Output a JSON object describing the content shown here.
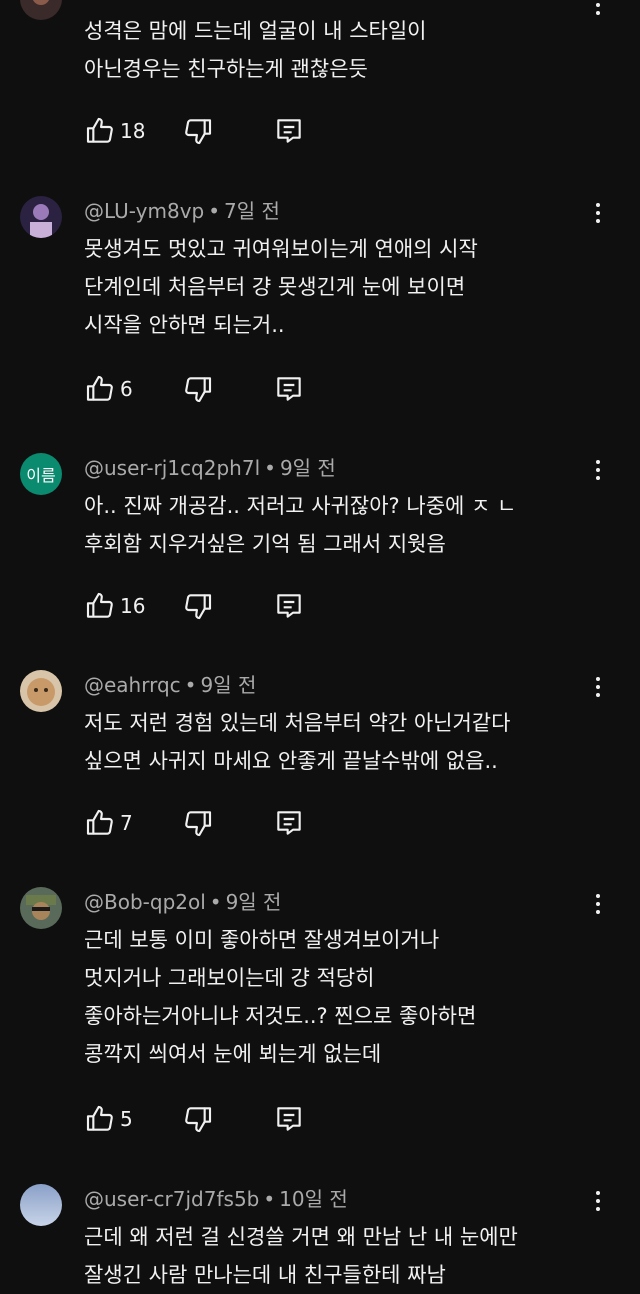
{
  "comments": [
    {
      "author": "",
      "time": "",
      "lines": [
        "성격은 맘에 드는데 얼굴이 내 스타일이",
        "아닌경우는 친구하는게 괜찮은듯"
      ],
      "likes": "18",
      "avatar": "photo-dark"
    },
    {
      "author": "@LU-ym8vp",
      "time": "7일 전",
      "lines": [
        "못생겨도 멋있고 귀여워보이는게 연애의 시작",
        "단계인데 처음부터 걍 못생긴게 눈에 보이면",
        "시작을 안하면 되는거.."
      ],
      "likes": "6",
      "avatar": "photo-purple"
    },
    {
      "author": "@user-rj1cq2ph7l",
      "time": "9일 전",
      "lines": [
        "아.. 진짜 개공감.. 저러고 사귀잖아? 나중에 ㅈ ㄴ",
        "후회함 지우거싶은 기억 됨 그래서 지웟음"
      ],
      "likes": "16",
      "avatar": "initial",
      "avatar_text": "이름",
      "avatar_color": "#0a8a6f"
    },
    {
      "author": "@eahrrqc",
      "time": "9일 전",
      "lines": [
        "저도 저런 경험 있는데 처음부터 약간 아닌거같다",
        "싶으면 사귀지 마세요 안좋게 끝날수밖에 없음.."
      ],
      "likes": "7",
      "avatar": "photo-cat"
    },
    {
      "author": "@Bob-qp2ol",
      "time": "9일 전",
      "lines": [
        "근데 보통 이미 좋아하면 잘생겨보이거나",
        "멋지거나 그래보이는데 걍 적당히",
        "좋아하는거아니냐 저것도..? 찐으로 좋아하면",
        "콩깍지 씌여서 눈에 뵈는게 없는데"
      ],
      "likes": "5",
      "avatar": "photo-soldier"
    },
    {
      "author": "@user-cr7jd7fs5b",
      "time": "10일 전",
      "lines": [
        "근데 왜 저런 걸 신경쓸 거면 왜 만남 난 내 눈에만",
        "잘생긴 사람 만나는데 내 친구들한테 짜남"
      ],
      "likes": "",
      "avatar": "photo-sky"
    }
  ],
  "icons": {
    "like": "thumbs-up-icon",
    "dislike": "thumbs-down-icon",
    "reply": "reply-icon",
    "more": "more-vertical-icon"
  }
}
